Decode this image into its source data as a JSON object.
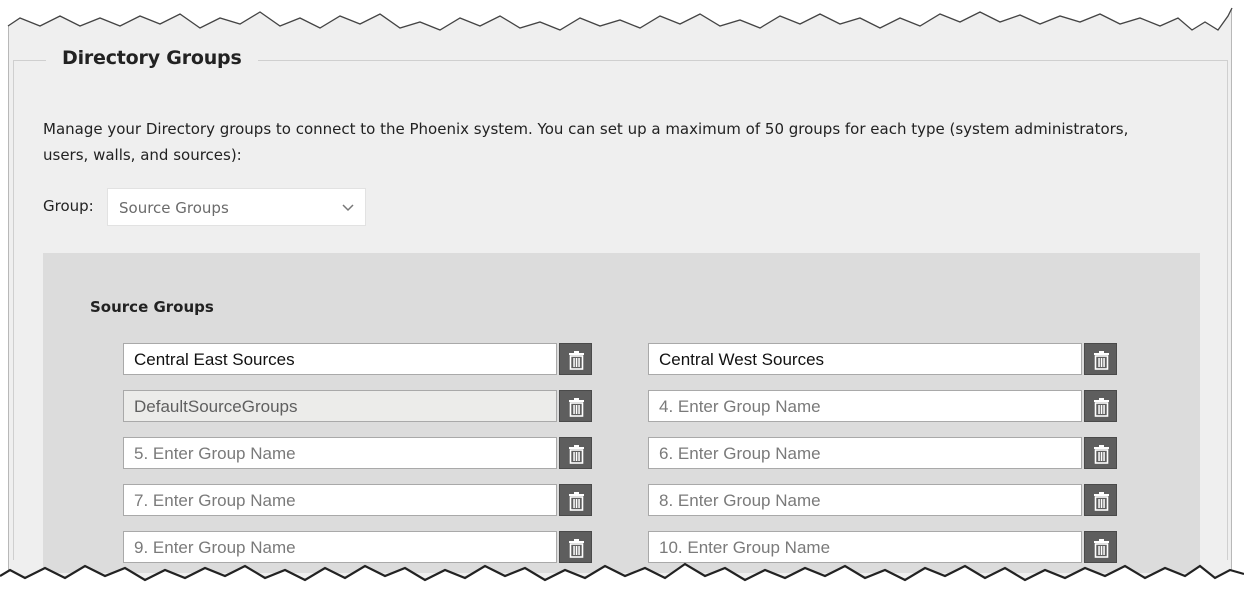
{
  "section": {
    "title": "Directory Groups",
    "description": "Manage your Directory groups to connect to the Phoenix system. You can set up a maximum of 50 groups for each type (system administrators, users, walls, and sources):"
  },
  "group_select": {
    "label": "Group:",
    "value": "Source Groups"
  },
  "source_groups": {
    "title": "Source Groups",
    "fields": [
      {
        "text": "Central East Sources",
        "state": "filled"
      },
      {
        "text": "Central West Sources",
        "state": "filled"
      },
      {
        "text": "DefaultSourceGroups",
        "state": "disabled"
      },
      {
        "text": "4. Enter Group Name",
        "state": "placeholder"
      },
      {
        "text": "5. Enter Group Name",
        "state": "placeholder"
      },
      {
        "text": "6. Enter Group Name",
        "state": "placeholder"
      },
      {
        "text": "7. Enter Group Name",
        "state": "placeholder"
      },
      {
        "text": "8. Enter Group Name",
        "state": "placeholder"
      },
      {
        "text": "9. Enter Group Name",
        "state": "placeholder"
      },
      {
        "text": "10. Enter Group Name",
        "state": "placeholder"
      }
    ]
  },
  "icons": {
    "delete": "trash-icon",
    "dropdown": "chevron-down-icon"
  }
}
